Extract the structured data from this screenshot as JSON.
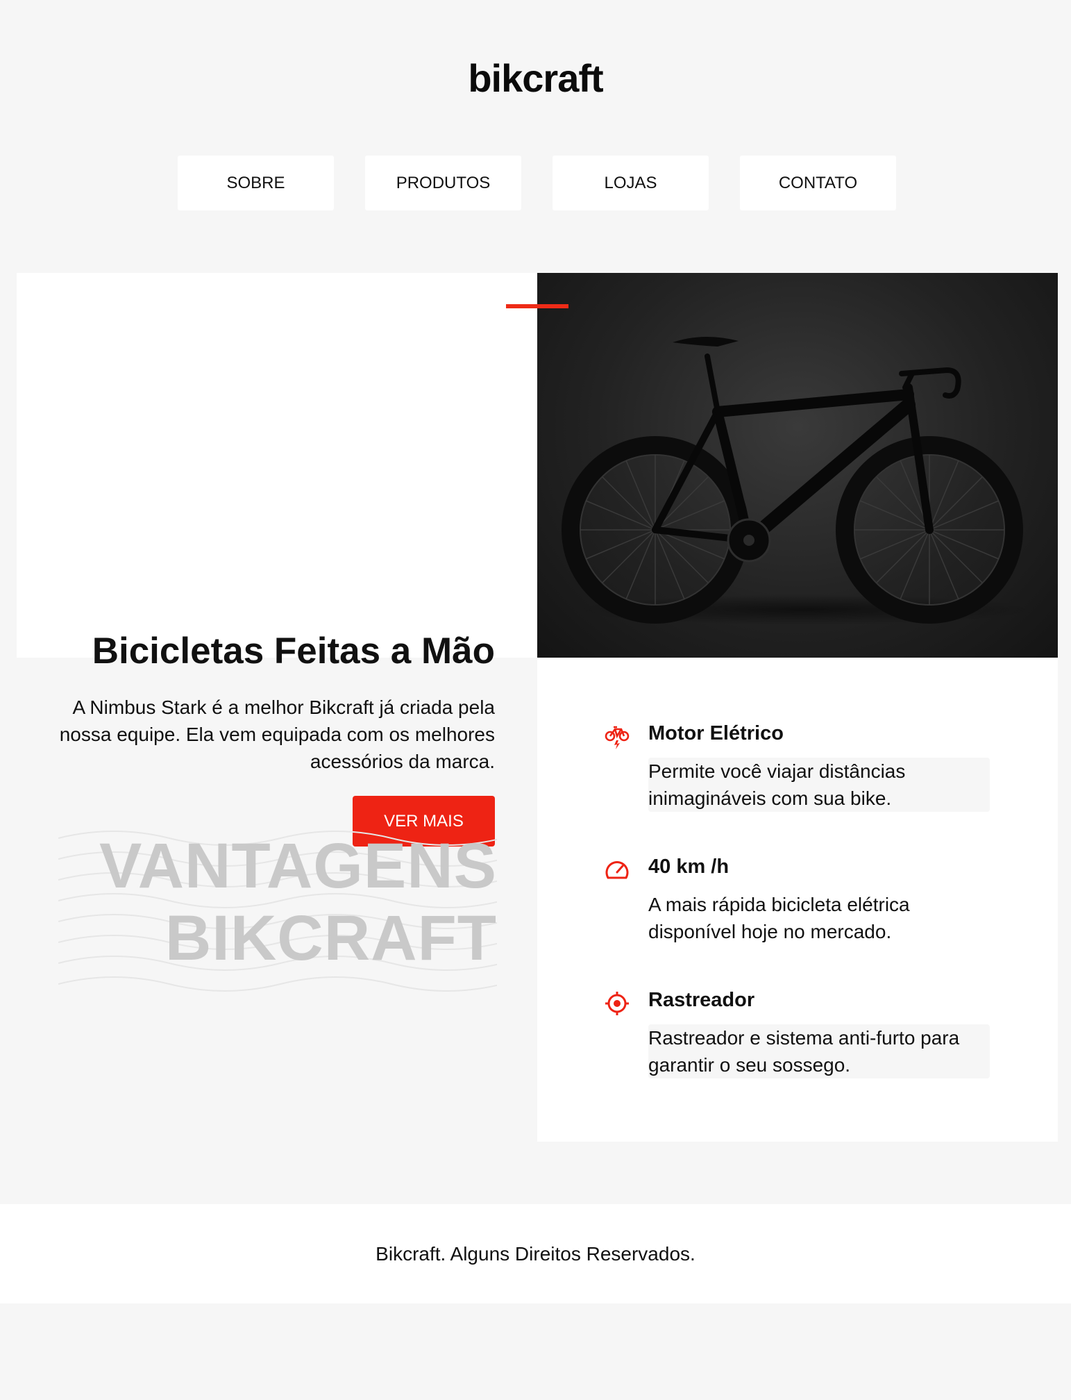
{
  "header": {
    "logo": "bikcraft"
  },
  "nav": {
    "items": [
      {
        "label": "SOBRE"
      },
      {
        "label": "PRODUTOS"
      },
      {
        "label": "LOJAS"
      },
      {
        "label": "CONTATO"
      }
    ]
  },
  "hero": {
    "title": "Bicicletas Feitas a Mão",
    "description": "A Nimbus Stark é a melhor Bikcraft já criada pela nossa equipe. Ela vem equipada com os melhores acessórios da marca.",
    "button_label": "VER MAIS",
    "image_icon": "bicycle-photo"
  },
  "advantages": {
    "title_line1": "VANTAGENS",
    "title_line2": "BIKCRAFT",
    "items": [
      {
        "icon": "electric-bike-icon",
        "title": "Motor Elétrico",
        "description": "Permite você viajar distâncias inimagináveis com sua bike."
      },
      {
        "icon": "speedometer-icon",
        "title": "40 km /h",
        "description": "A mais rápida bicicleta elétrica disponível hoje no mercado."
      },
      {
        "icon": "target-icon",
        "title": "Rastreador",
        "description": "Rastreador e sistema anti-furto para garantir o seu sossego."
      }
    ]
  },
  "footer": {
    "text": "Bikcraft. Alguns Direitos Reservados."
  },
  "colors": {
    "accent": "#ee2314",
    "background": "#f6f6f6",
    "surface": "#ffffff",
    "muted_title": "#c9c9c9"
  }
}
